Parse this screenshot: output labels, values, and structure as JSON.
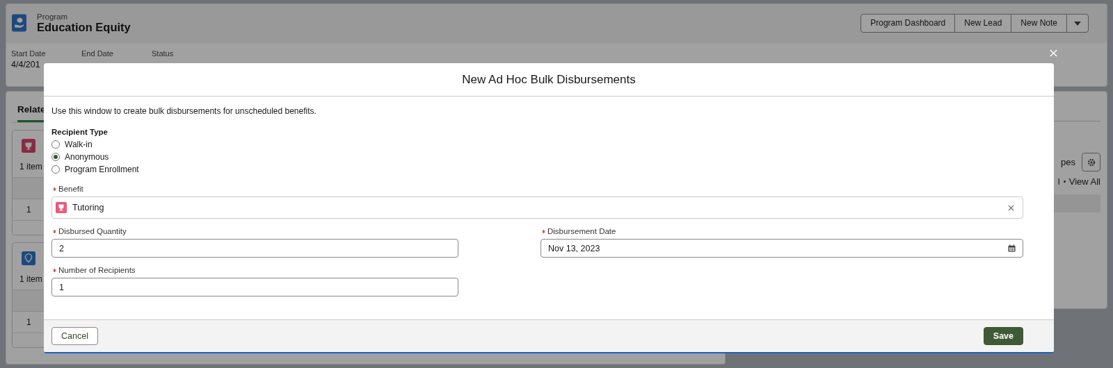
{
  "record_header": {
    "object_label": "Program",
    "title": "Education Equity",
    "actions": [
      {
        "label": "Program Dashboard"
      },
      {
        "label": "New Lead"
      },
      {
        "label": "New Note"
      }
    ]
  },
  "highlights": [
    {
      "label": "Start Date",
      "value": "4/4/201"
    },
    {
      "label": "End Date"
    },
    {
      "label": "Status"
    }
  ],
  "related_tab": {
    "label": "Relate",
    "selected": true
  },
  "related_lists": [
    {
      "kind": "trophy",
      "count": "1 item",
      "row_number": "1"
    },
    {
      "kind": "pin",
      "count": "1 item",
      "row_number": "1"
    }
  ],
  "side_panel": {
    "text": "pes",
    "links": [
      "l",
      "View All"
    ]
  },
  "modal": {
    "title": "New Ad Hoc Bulk Disbursements",
    "intro": "Use this window to create bulk disbursements for unscheduled benefits.",
    "recipient_type": {
      "label": "Recipient Type",
      "options": [
        {
          "label": "Walk-in",
          "selected": false
        },
        {
          "label": "Anonymous",
          "selected": true
        },
        {
          "label": "Program Enrollment",
          "selected": false
        }
      ]
    },
    "benefit": {
      "label": "Benefit",
      "required": true,
      "value": "Tutoring"
    },
    "fields": [
      {
        "kind": "text",
        "label": "Disbursed Quantity",
        "required": true,
        "value": "2"
      },
      {
        "kind": "date",
        "label": "Disbursement Date",
        "required": true,
        "value": "Nov 13, 2023"
      },
      {
        "kind": "text",
        "label": "Number of Recipients",
        "required": true,
        "value": "1"
      }
    ],
    "cancel": "Cancel",
    "save": "Save"
  }
}
